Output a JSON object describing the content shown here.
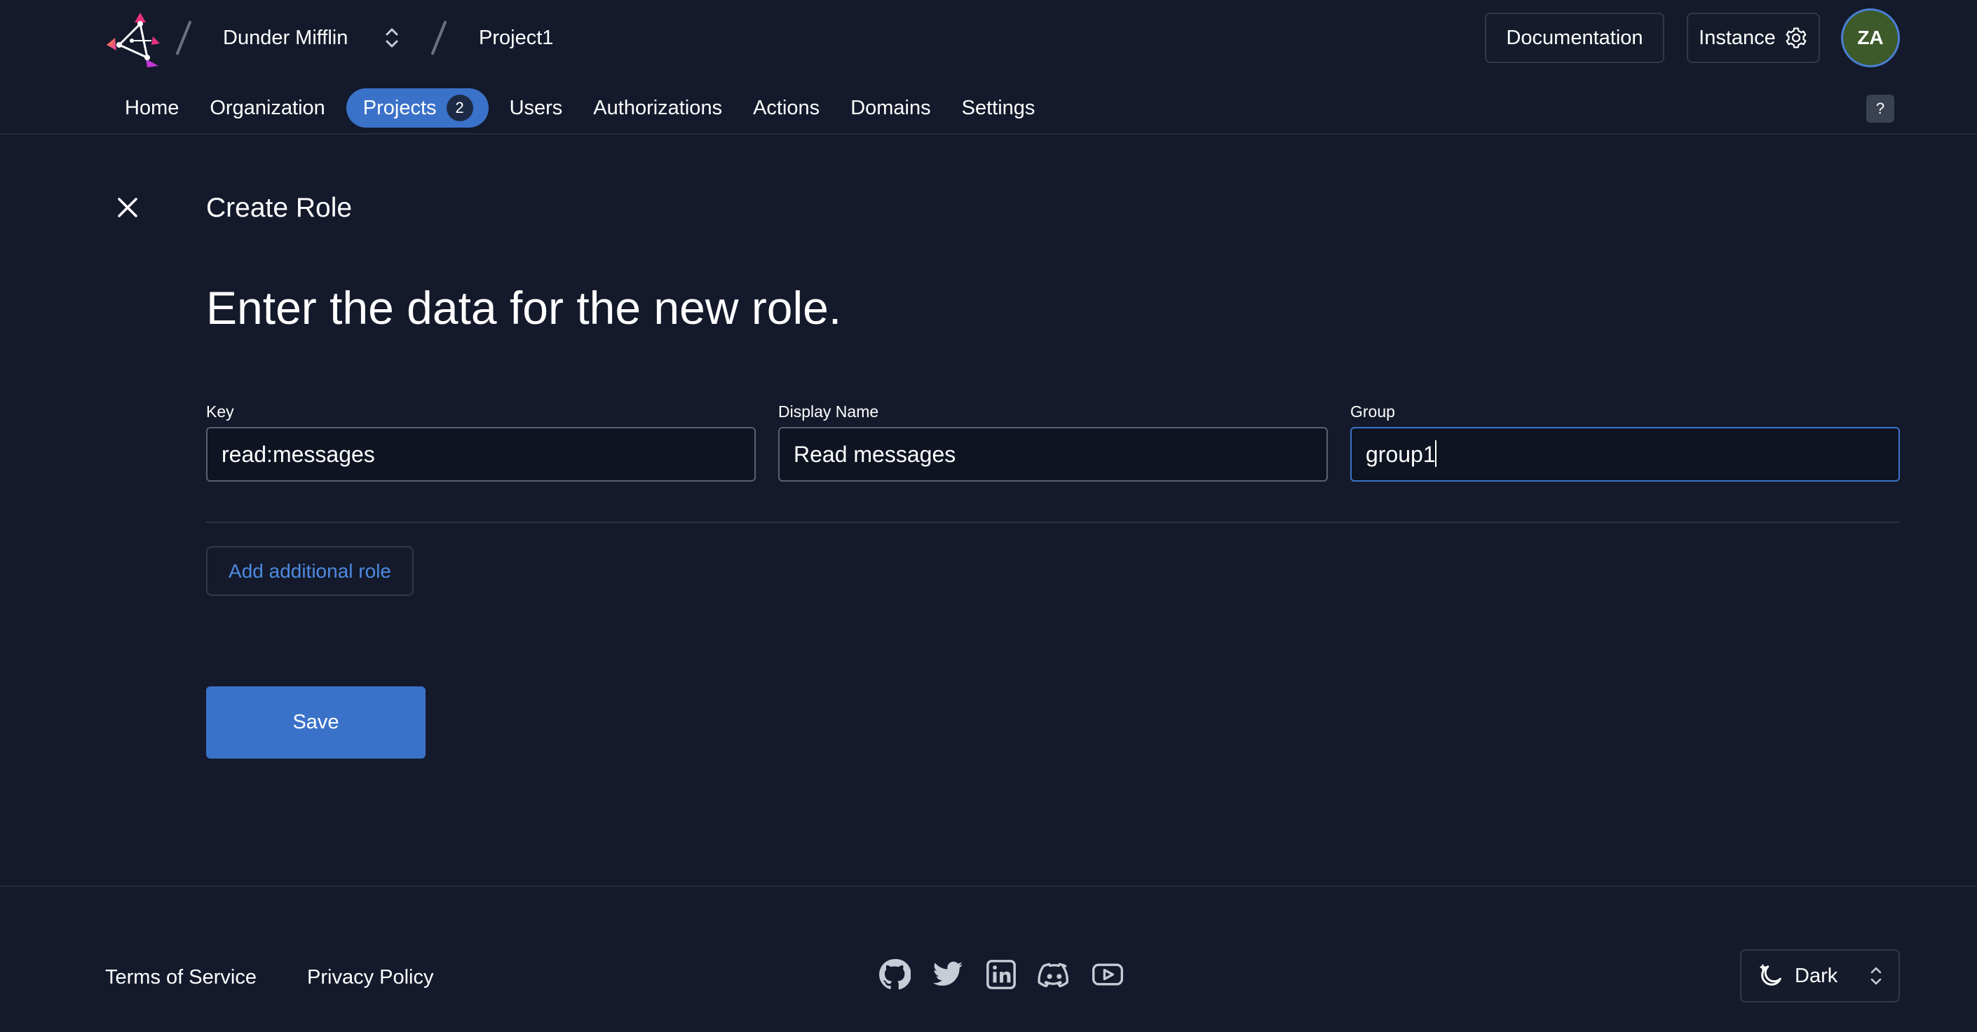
{
  "header": {
    "org_name": "Dunder Mifflin",
    "project_name": "Project1",
    "documentation_label": "Documentation",
    "instance_label": "Instance",
    "avatar_initials": "ZA"
  },
  "nav": {
    "items": [
      {
        "label": "Home"
      },
      {
        "label": "Organization"
      },
      {
        "label": "Projects",
        "badge": "2",
        "active": true
      },
      {
        "label": "Users"
      },
      {
        "label": "Authorizations"
      },
      {
        "label": "Actions"
      },
      {
        "label": "Domains"
      },
      {
        "label": "Settings"
      }
    ],
    "help_label": "?"
  },
  "main": {
    "page_title": "Create Role",
    "heading": "Enter the data for the new role.",
    "fields": {
      "key": {
        "label": "Key",
        "value": "read:messages"
      },
      "display_name": {
        "label": "Display Name",
        "value": "Read messages"
      },
      "group": {
        "label": "Group",
        "value": "group1"
      }
    },
    "add_role_label": "Add additional role",
    "save_label": "Save"
  },
  "footer": {
    "terms_label": "Terms of Service",
    "privacy_label": "Privacy Policy",
    "social_icons": [
      "github-icon",
      "twitter-icon",
      "linkedin-icon",
      "discord-icon",
      "youtube-icon"
    ],
    "theme_label": "Dark"
  },
  "colors": {
    "background": "#141a2b",
    "accent": "#3b72c9",
    "link": "#4d8ae0",
    "border": "#30384c"
  }
}
